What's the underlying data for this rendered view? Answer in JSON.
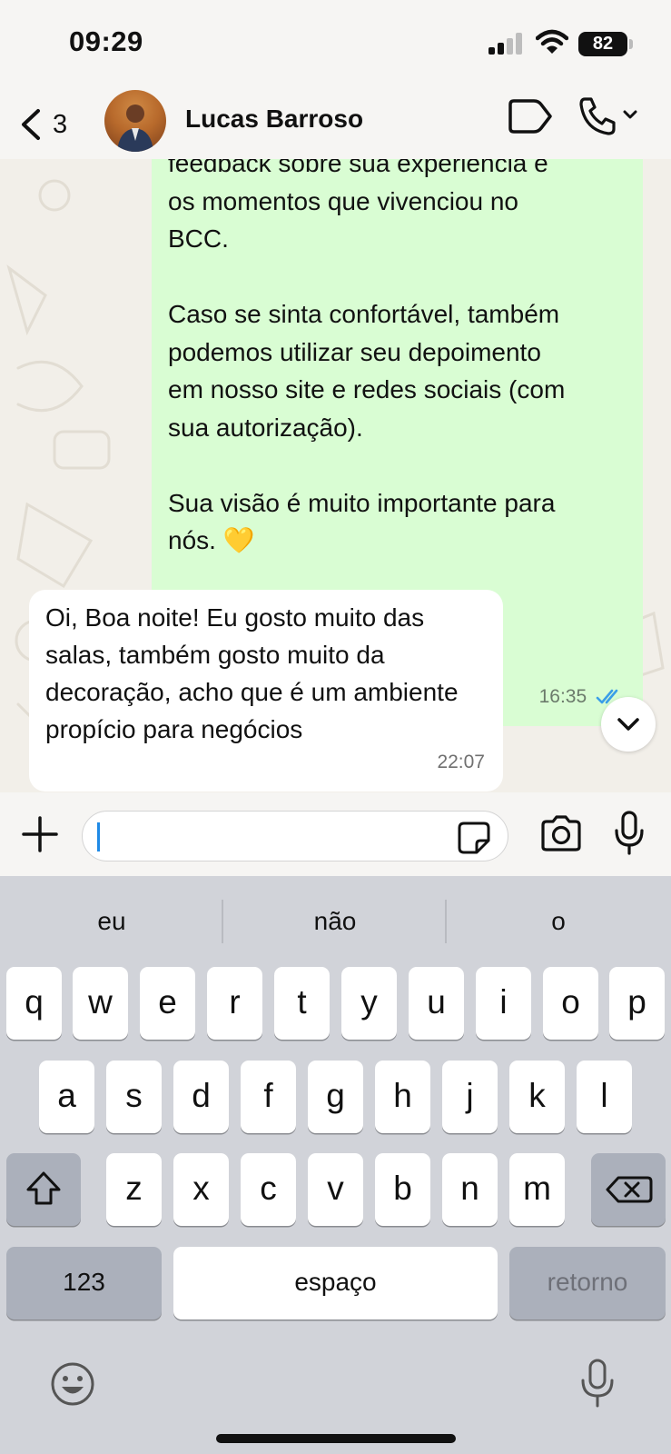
{
  "status_bar": {
    "time": "09:29",
    "battery": "82"
  },
  "header": {
    "back_count": "3",
    "contact_name": "Lucas Barroso"
  },
  "messages": {
    "outgoing": {
      "text": "feedback sobre sua experiência e\nos momentos que vivenciou no\nBCC.\n\nCaso se sinta confortável, também\npodemos utilizar seu depoimento\nem nosso site e redes sociais (com\nsua autorização).\n\nSua visão é muito importante para\nnós. 💛",
      "time": "16:35"
    },
    "incoming": {
      "text": "Oi, Boa noite! Eu gosto muito das salas, também gosto muito da decoração, acho que é um ambiente propício para negócios",
      "time": "22:07"
    }
  },
  "keyboard": {
    "suggestions": [
      "eu",
      "não",
      "o"
    ],
    "row1": [
      "q",
      "w",
      "e",
      "r",
      "t",
      "y",
      "u",
      "i",
      "o",
      "p"
    ],
    "row2": [
      "a",
      "s",
      "d",
      "f",
      "g",
      "h",
      "j",
      "k",
      "l"
    ],
    "row3": [
      "z",
      "x",
      "c",
      "v",
      "b",
      "n",
      "m"
    ],
    "numbers_label": "123",
    "space_label": "espaço",
    "return_label": "retorno"
  },
  "colors": {
    "outgoing_bubble": "#d9fdd3",
    "incoming_bubble": "#ffffff",
    "read_ticks": "#3a9ee8",
    "keyboard_bg": "#d1d3d9"
  },
  "icons": [
    "chevron-left-icon",
    "video-icon",
    "phone-icon",
    "chevron-down-icon",
    "plus-icon",
    "sticker-icon",
    "camera-icon",
    "microphone-icon",
    "shift-icon",
    "backspace-icon",
    "emoji-icon",
    "dictation-icon"
  ]
}
